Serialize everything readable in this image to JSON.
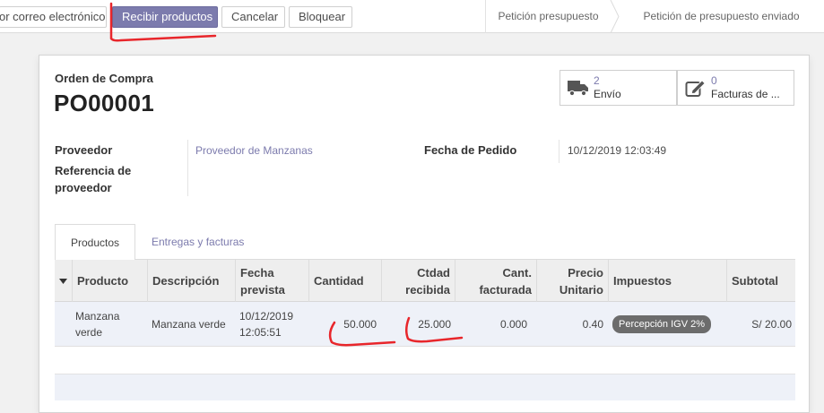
{
  "toolbar": {
    "email_label": "or correo electrónico",
    "receive_label": "Recibir productos",
    "cancel_label": "Cancelar",
    "block_label": "Bloquear"
  },
  "statusbar": {
    "stages": [
      "Petición presupuesto",
      "Petición de presupuesto enviado"
    ]
  },
  "record": {
    "subtitle": "Orden de Compra",
    "name": "PO00001"
  },
  "smart_buttons": {
    "shipments": {
      "count": "2",
      "label": "Envío",
      "icon": "truck-icon"
    },
    "invoices": {
      "count": "0",
      "label": "Facturas de ...",
      "icon": "edit-icon"
    }
  },
  "fields": {
    "vendor_label": "Proveedor",
    "vendor_value": "Proveedor de Manzanas",
    "vendor_ref_label_1": "Referencia de",
    "vendor_ref_label_2": "proveedor",
    "order_date_label": "Fecha de Pedido",
    "order_date_value": "10/12/2019 12:03:49"
  },
  "tabs": {
    "products": "Productos",
    "deliveries": "Entregas y facturas"
  },
  "table": {
    "headers": {
      "product": "Producto",
      "description": "Descripción",
      "date_1": "Fecha",
      "date_2": "prevista",
      "qty": "Cantidad",
      "received_1": "Ctdad",
      "received_2": "recibida",
      "invoiced_1": "Cant.",
      "invoiced_2": "facturada",
      "price_1": "Precio",
      "price_2": "Unitario",
      "taxes": "Impuestos",
      "subtotal": "Subtotal"
    },
    "rows": [
      {
        "product_1": "Manzana",
        "product_2": "verde",
        "description": "Manzana verde",
        "date_1": "10/12/2019",
        "date_2": "12:05:51",
        "qty": "50.000",
        "received": "25.000",
        "invoiced": "0.000",
        "price": "0.40",
        "tax": "Percepción IGV 2%",
        "subtotal": "S/ 20.00"
      }
    ]
  },
  "colors": {
    "primary": "#7c7bad",
    "annotation": "#e8262b"
  }
}
